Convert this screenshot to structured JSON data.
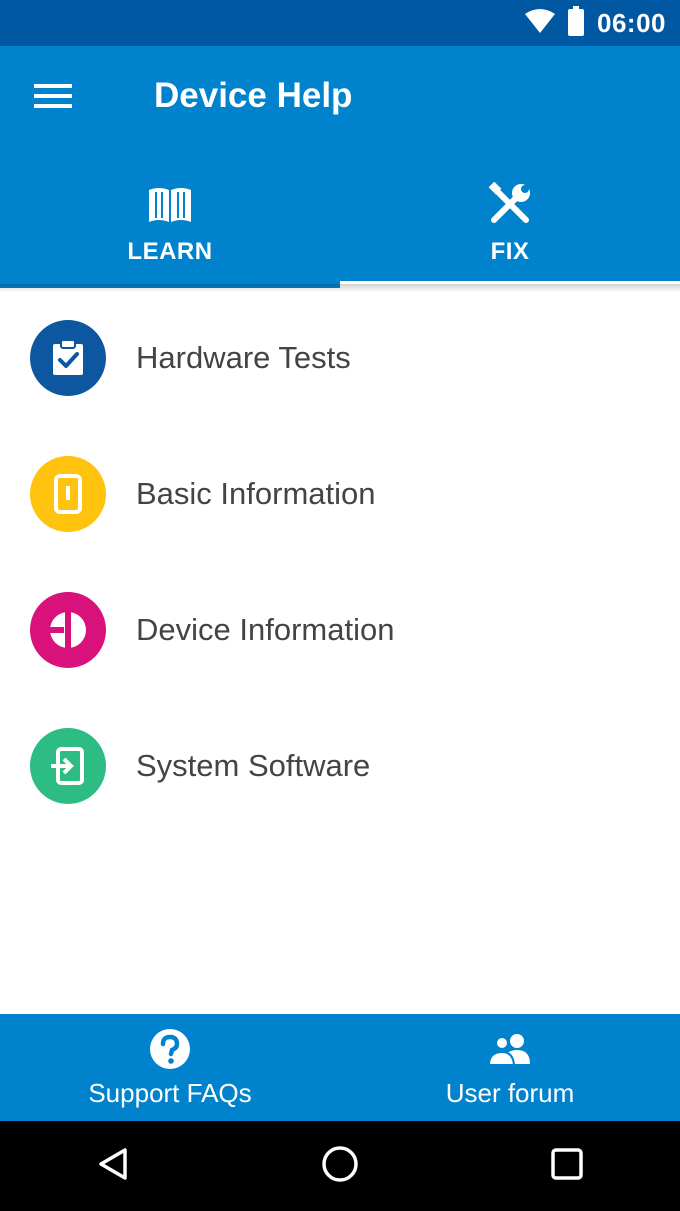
{
  "status_bar": {
    "time": "06:00",
    "icons": [
      "wifi-icon",
      "battery-icon"
    ]
  },
  "app_bar": {
    "title": "Device Help",
    "menu_icon": "hamburger-menu-icon"
  },
  "tabs": [
    {
      "label": "LEARN",
      "icon": "book-icon"
    },
    {
      "label": "FIX",
      "icon": "tools-icon",
      "selected": true
    }
  ],
  "list": [
    {
      "label": "Hardware Tests",
      "icon": "clipboard-check-icon",
      "color": "#0d57a0"
    },
    {
      "label": "Basic Information",
      "icon": "phone-icon",
      "color": "#ffc20e"
    },
    {
      "label": "Device Information",
      "icon": "device-info-icon",
      "color": "#d8127a"
    },
    {
      "label": "System Software",
      "icon": "software-update-icon",
      "color": "#2dbc83"
    }
  ],
  "bottom_bar": [
    {
      "label": "Support FAQs",
      "icon": "question-icon"
    },
    {
      "label": "User forum",
      "icon": "users-icon"
    }
  ],
  "nav_bar": [
    "back-icon",
    "home-icon",
    "recents-icon"
  ],
  "colors": {
    "status_bar": "#0058a3",
    "primary": "#0083cc",
    "text": "#444444"
  }
}
